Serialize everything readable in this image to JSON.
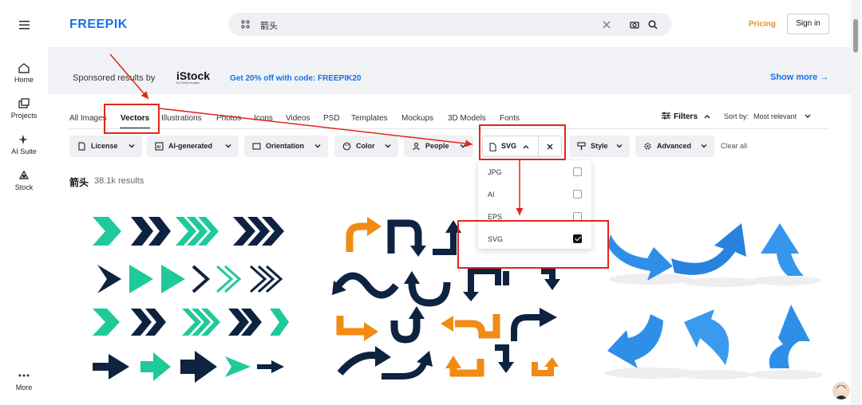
{
  "rail": {
    "home": "Home",
    "projects": "Projects",
    "ai_suite": "AI Suite",
    "stock": "Stock",
    "more": "More"
  },
  "header": {
    "logo": "FREEPIK",
    "search_query": "箭头",
    "pricing": "Pricing",
    "signin": "Sign in"
  },
  "sponsor": {
    "label": "Sponsored results by",
    "brand": "iStock",
    "brand_sub": "by Getty Images",
    "code_text": "Get 20% off with code: FREEPIK20",
    "show_more": "Show more →"
  },
  "tabs": [
    "All Images",
    "Vectors",
    "Illustrations",
    "Photos",
    "Icons",
    "Videos",
    "PSD",
    "Templates",
    "Mockups",
    "3D Models",
    "Fonts"
  ],
  "active_tab": "Vectors",
  "toolbar": {
    "filters": "Filters",
    "sort_label": "Sort by:",
    "sort_value": "Most relevant"
  },
  "chips": [
    "License",
    "AI-generated",
    "Orientation",
    "Color",
    "People",
    "Style",
    "Advanced"
  ],
  "svg_chip": "SVG",
  "clear_all": "Clear all",
  "dropdown_options": [
    {
      "label": "JPG",
      "checked": false
    },
    {
      "label": "AI",
      "checked": false
    },
    {
      "label": "EPS",
      "checked": false
    },
    {
      "label": "SVG",
      "checked": true
    }
  ],
  "results": {
    "query": "箭头",
    "count": "38.1k results"
  },
  "colors": {
    "brand_blue": "#1273eb",
    "pricing": "#e0902a",
    "annotation_red": "#e2261c",
    "arrow_green": "#1ec99a",
    "arrow_navy": "#0d2340",
    "arrow_orange": "#f28a14",
    "arrow_blue": "#2f8fe8"
  }
}
